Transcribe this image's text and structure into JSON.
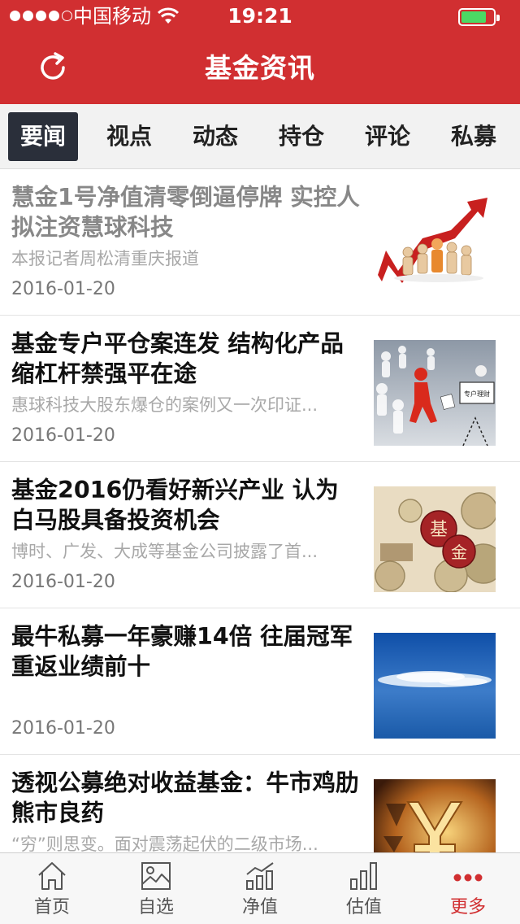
{
  "status_bar": {
    "carrier": "中国移动",
    "time": "19:21"
  },
  "nav": {
    "title": "基金资讯",
    "left_icon": "refresh-icon"
  },
  "tabs": [
    {
      "label": "要闻",
      "active": true
    },
    {
      "label": "视点",
      "active": false
    },
    {
      "label": "动态",
      "active": false
    },
    {
      "label": "持仓",
      "active": false
    },
    {
      "label": "评论",
      "active": false
    },
    {
      "label": "私募",
      "active": false
    }
  ],
  "news": [
    {
      "title": "慧金1号净值清零倒逼停牌 实控人拟注资慧球科技",
      "summary": "本报记者周松清重庆报道",
      "date": "2016-01-20",
      "read": true,
      "thumb": "rising-arrow-figures"
    },
    {
      "title": "基金专户平仓案连发 结构化产品缩杠杆禁强平在途",
      "summary": "惠球科技大股东爆仓的案例又一次印证...",
      "date": "2016-01-20",
      "read": false,
      "thumb": "walking-figures",
      "thumb_sign": "专户理财"
    },
    {
      "title": "基金2016仍看好新兴产业 认为白马股具备投资机会",
      "summary": "博时、广发、大成等基金公司披露了首...",
      "date": "2016-01-20",
      "read": false,
      "thumb": "coins",
      "thumb_text_1": "基",
      "thumb_text_2": "金"
    },
    {
      "title": "最牛私募一年豪赚14倍 往届冠军重返业绩前十",
      "summary": "",
      "date": "2016-01-20",
      "read": false,
      "thumb": "cloud-sky"
    },
    {
      "title": "透视公募绝对收益基金：牛市鸡肋 熊市良药",
      "summary": "“穷”则思变。面对震荡起伏的二级市场...",
      "date": "",
      "read": false,
      "thumb": "yen-sign"
    }
  ],
  "bottom_tabs": [
    {
      "label": "首页",
      "icon": "home-icon",
      "active": false
    },
    {
      "label": "自选",
      "icon": "picture-icon",
      "active": false
    },
    {
      "label": "净值",
      "icon": "line-chart-icon",
      "active": false
    },
    {
      "label": "估值",
      "icon": "bar-chart-icon",
      "active": false
    },
    {
      "label": "更多",
      "icon": "more-icon",
      "active": true
    }
  ],
  "colors": {
    "brand": "#d12f31",
    "tab_active_bg": "#2a2f3a"
  }
}
